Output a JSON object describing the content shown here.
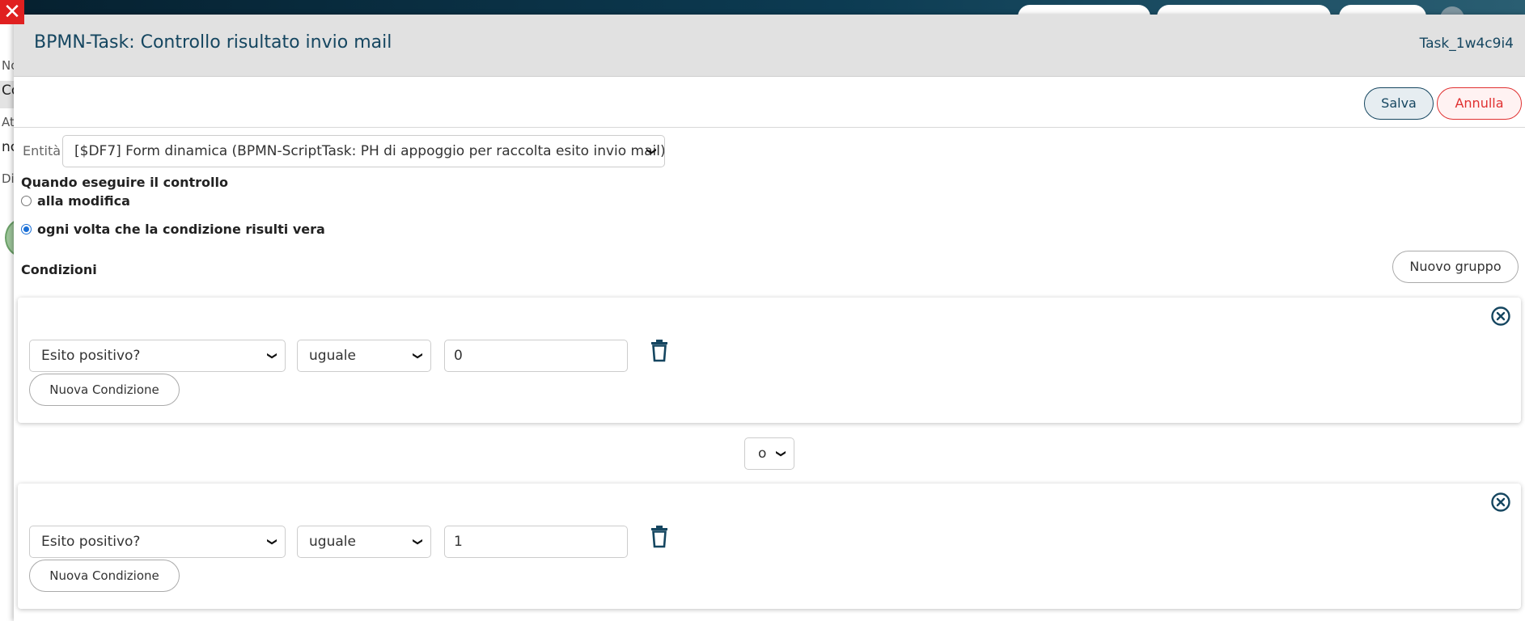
{
  "background": {
    "fragments": [
      "No",
      "Co",
      "At",
      "nc",
      "Di"
    ]
  },
  "modal": {
    "title": "BPMN-Task: Controllo risultato invio mail",
    "task_id": "Task_1w4c9i4",
    "buttons": {
      "save": "Salva",
      "cancel": "Annulla"
    }
  },
  "entity": {
    "label": "Entità",
    "value": "[$DF7] Form dinamica (BPMN-ScriptTask: PH di appoggio per raccolta esito invio mail)"
  },
  "when": {
    "title": "Quando eseguire il controllo",
    "options": [
      {
        "label": "alla modifica",
        "checked": false
      },
      {
        "label": "ogni volta che la condizione risulti vera",
        "checked": true
      }
    ]
  },
  "conditions": {
    "title": "Condizioni",
    "new_group_label": "Nuovo gruppo",
    "groups": [
      {
        "field": "Esito positivo?",
        "operator": "uguale",
        "value": "0",
        "new_condition_label": "Nuova Condizione"
      },
      {
        "field": "Esito positivo?",
        "operator": "uguale",
        "value": "1",
        "new_condition_label": "Nuova Condizione"
      }
    ],
    "join_operator": "o"
  },
  "colors": {
    "title": "#154660",
    "close": "#e02020",
    "cancel": "#e03030",
    "radio_checked": "#1a6fd6"
  },
  "icons": [
    "close-icon",
    "trash-icon",
    "remove-group-icon",
    "chevron-down-icon"
  ]
}
